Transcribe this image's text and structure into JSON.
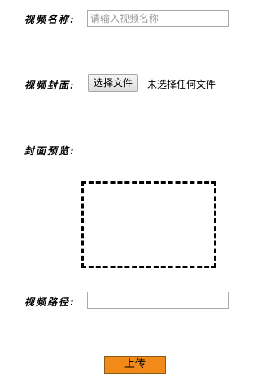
{
  "form": {
    "video_name": {
      "label": "视频名称:",
      "placeholder": "请输入视频名称",
      "value": ""
    },
    "video_cover": {
      "label": "视频封面:",
      "button_label": "选择文件",
      "status_text": "未选择任何文件"
    },
    "cover_preview": {
      "label": "封面预览:"
    },
    "video_path": {
      "label": "视频路径:",
      "value": ""
    },
    "submit": {
      "label": "上传",
      "color": "#f28a1a"
    }
  }
}
